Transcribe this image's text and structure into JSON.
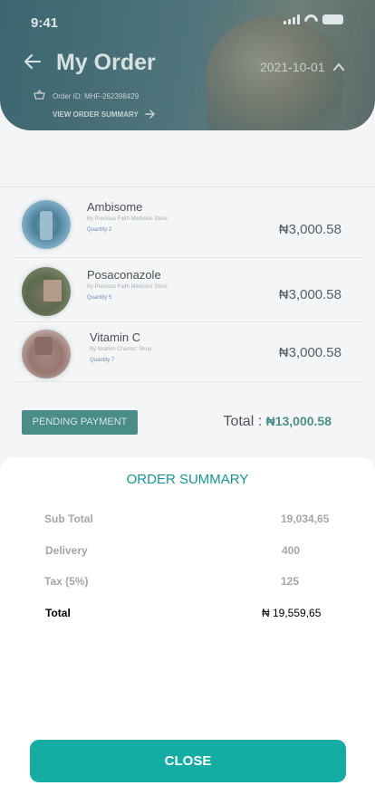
{
  "status_bar": {
    "time": "9:41"
  },
  "header": {
    "title": "My Order",
    "date": "2021-10-01",
    "order_id": "Order ID: MHF-262398429",
    "view_summary": "VIEW ORDER SUMMARY"
  },
  "items": [
    {
      "name": "Ambisome",
      "seller": "By Precious Faith Medicine Store",
      "quantity": "Quantity 2",
      "price": "₦3,000.58"
    },
    {
      "name": "Posaconazole",
      "seller": "By Precious Faith Medicine Store",
      "quantity": "Quantity 5",
      "price": "₦3,000.58"
    },
    {
      "name": "Vitamin C",
      "seller": "By Ibrahim Charms' Shop",
      "quantity": "Quantity 7",
      "price": "₦3,000.58"
    }
  ],
  "footer": {
    "status_label": "PENDING PAYMENT",
    "total_label": "Total : ",
    "total_amount": "₦13,000.58"
  },
  "summary": {
    "title": "ORDER SUMMARY",
    "rows": [
      {
        "label": "Sub Total",
        "value": "19,034,65"
      },
      {
        "label": "Delivery",
        "value": "400"
      },
      {
        "label": "Tax (5%)",
        "value": "125"
      }
    ],
    "total": {
      "label": "Total",
      "value": "₦ 19,559,65"
    },
    "close_label": "CLOSE"
  },
  "colors": {
    "accent": "#14aca3",
    "title_accent": "#16958f"
  },
  "icons": [
    "back-arrow-icon",
    "chevron-up-icon",
    "basket-icon",
    "arrow-right-icon",
    "signal-icon",
    "wifi-icon",
    "battery-icon"
  ]
}
